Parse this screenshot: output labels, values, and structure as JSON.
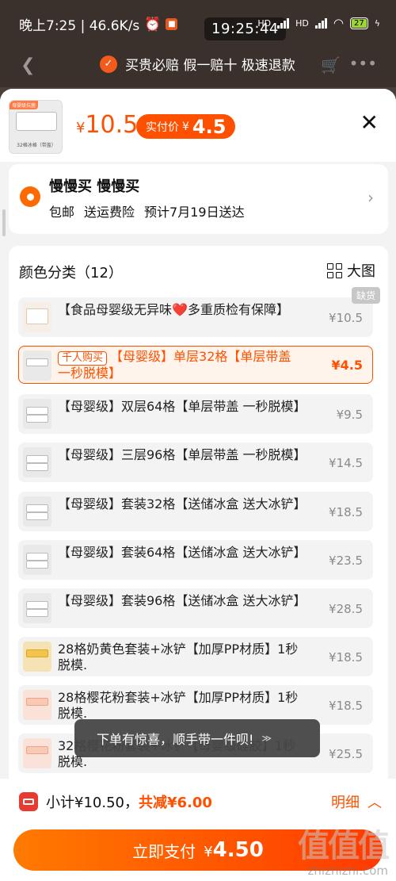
{
  "status_bar": {
    "time_speed": "晚上7:25 | 46.6K/s",
    "clock": "19:25:44",
    "network": "HD",
    "battery": "27"
  },
  "top_nav": {
    "guarantee": "买贵必赔 假一赔十 极速退款"
  },
  "product": {
    "thumb_tag": "母婴级抗菌",
    "thumb_caption": "32格冰格（带盖）",
    "price_currency": "¥",
    "price": "10.5",
    "pay_label": "实付价",
    "pay_currency": "¥",
    "pay_price": "4.5"
  },
  "address": {
    "name": "慢慢买 慢慢买",
    "shipping": [
      "包邮",
      "送运费险",
      "预计7月19日送达"
    ]
  },
  "options": {
    "title": "颜色分类（12）",
    "big_view_label": "大图",
    "out_of_stock_badge": "缺货",
    "badge_qianren": "千人购买",
    "items": [
      {
        "label_a": "【食品母婴级无异味",
        "heart": "❤️",
        "label_b": "多重质检有保障】",
        "price": "¥10.5",
        "thumb": "doc"
      },
      {
        "label": "【母婴级】单层32格【单层带盖 一秒脱模】",
        "price": "¥4.5",
        "thumb": "tray",
        "selected": true
      },
      {
        "label": "【母婴级】双层64格【单层带盖 一秒脱模】",
        "price": "¥9.5",
        "thumb": "tray"
      },
      {
        "label": "【母婴级】三层96格【单层带盖 一秒脱模】",
        "price": "¥14.5",
        "thumb": "tray"
      },
      {
        "label": "【母婴级】套装32格【送储冰盒 送大冰铲】",
        "price": "¥18.5",
        "thumb": "tray"
      },
      {
        "label": "【母婴级】套装64格【送储冰盒 送大冰铲】",
        "price": "¥23.5",
        "thumb": "tray"
      },
      {
        "label": "【母婴级】套装96格【送储冰盒 送大冰铲】",
        "price": "¥28.5",
        "thumb": "tray"
      },
      {
        "label": "28格奶黄色套装+冰铲【加厚PP材质】1秒脱模.",
        "price": "¥18.5",
        "thumb": "yellow"
      },
      {
        "label": "28格樱花粉套装+冰铲【加厚PP材质】1秒脱模.",
        "price": "¥18.5",
        "thumb": "pink"
      },
      {
        "label": "32格樱花粉套装+冰铲【母婴级硅胶】1秒脱模.",
        "price": "¥25.5",
        "thumb": "pink"
      }
    ]
  },
  "toast": {
    "text": "下单有惊喜，顺手带一件呗!",
    "chevron": "≫"
  },
  "bottom": {
    "subtotal": "小计¥10.50，",
    "discount": "共减¥6.00",
    "detail_label": "明细",
    "pay_label": "立即支付",
    "pay_currency": "¥",
    "pay_amount": "4.50"
  },
  "watermark": {
    "chars": "值值值",
    "url": "zhizhizhi.com"
  },
  "colors": {
    "accent": "#ff5000",
    "selected_bg": "#fff4ec"
  }
}
